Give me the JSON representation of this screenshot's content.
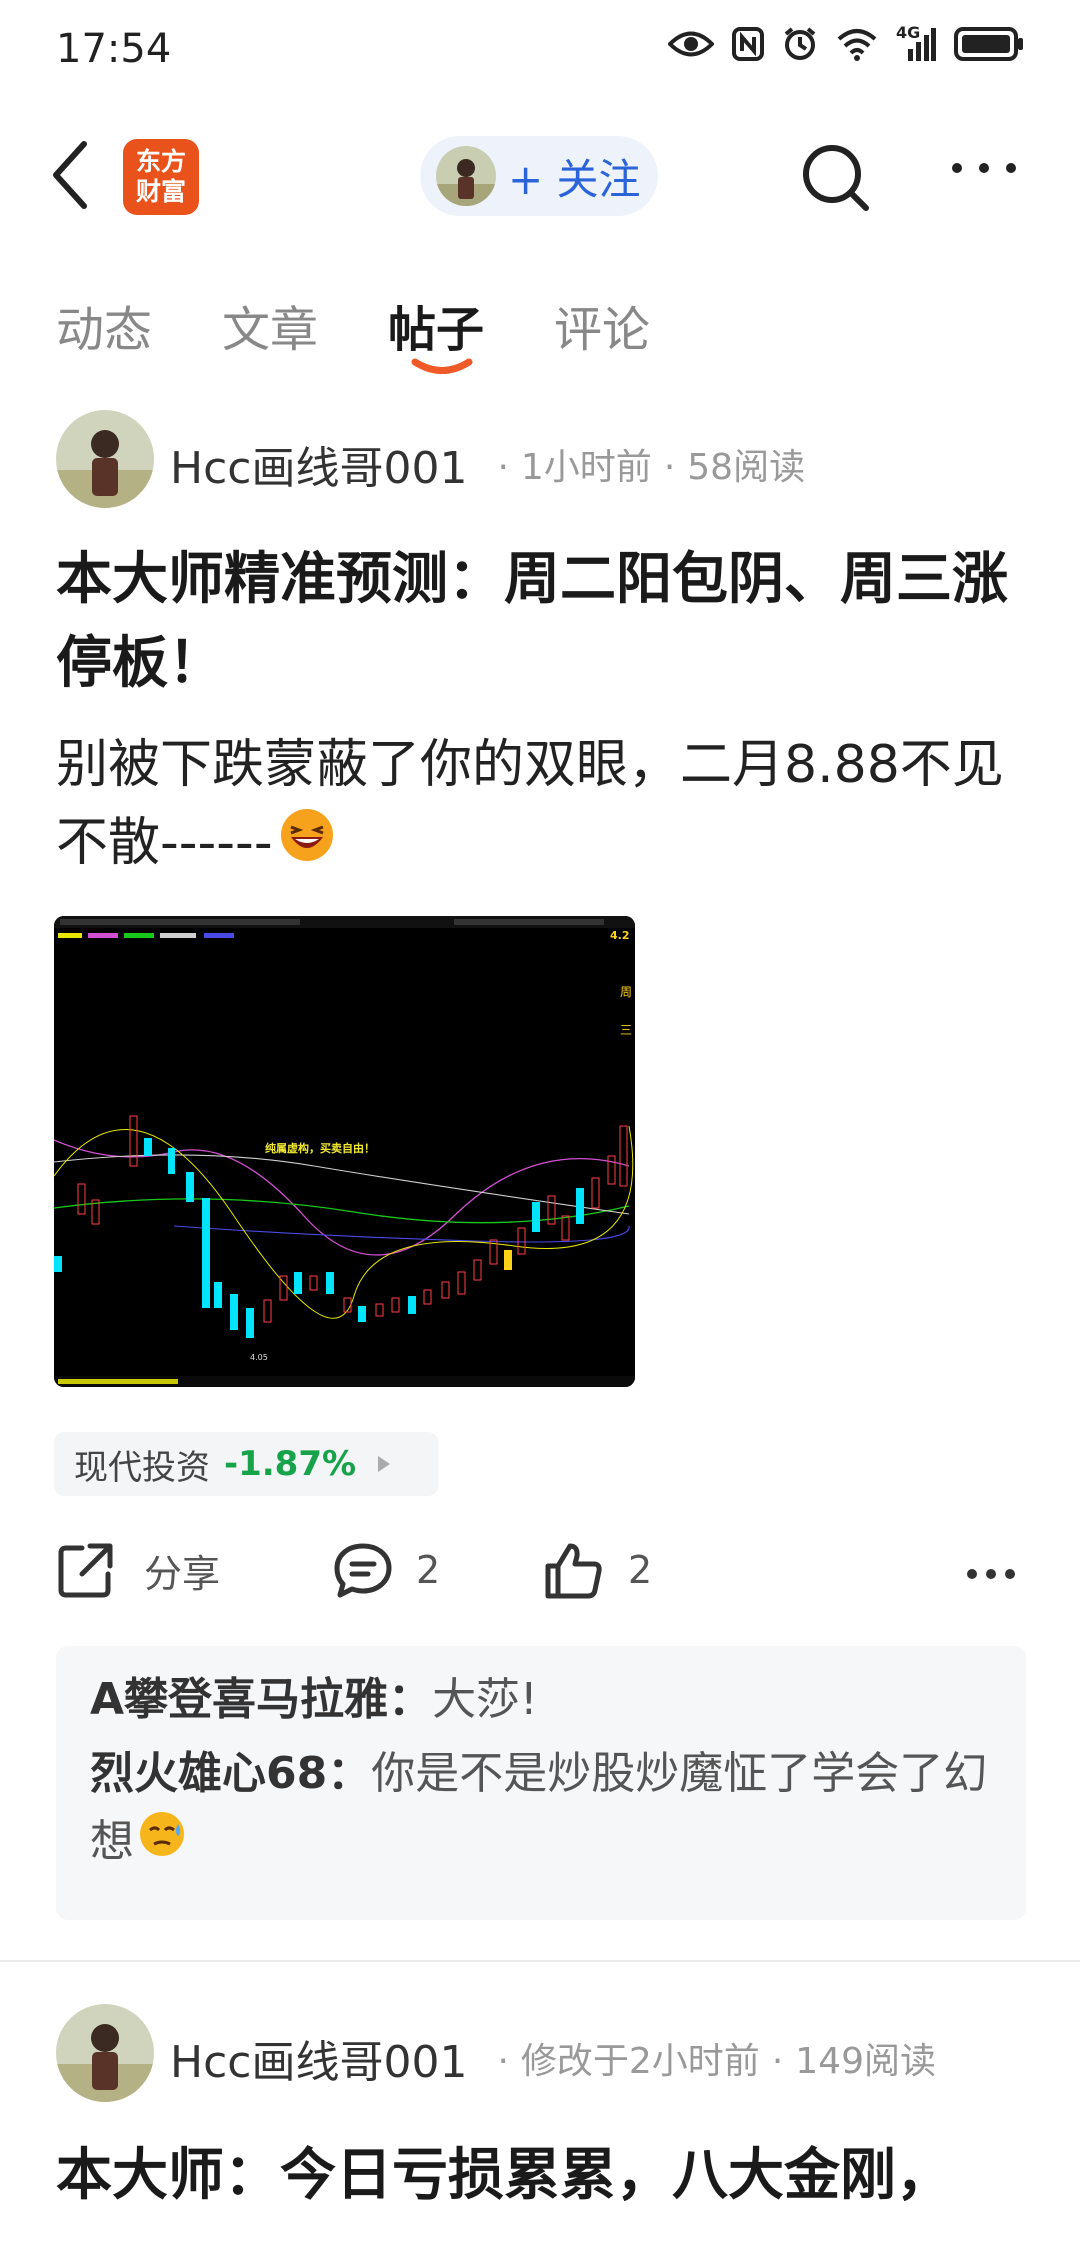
{
  "status_bar": {
    "time": "17:54",
    "network": "4G"
  },
  "header": {
    "logo_line1": "东方",
    "logo_line2": "财富",
    "follow_label": "+ 关注"
  },
  "tabs": [
    {
      "label": "动态",
      "active": false
    },
    {
      "label": "文章",
      "active": false
    },
    {
      "label": "帖子",
      "active": true
    },
    {
      "label": "评论",
      "active": false
    }
  ],
  "posts": [
    {
      "author": "Hcc画线哥001",
      "time": "1小时前",
      "reads": "58阅读",
      "title": "本大师精准预测：周二阳包阴、周三涨停板！",
      "body": "别被下跌蒙蔽了你的双眼，二月8.88不见不散------",
      "chart_caption": "纯属虚构，买卖自由！",
      "chart_low_label": "4.05",
      "chart_last_price": "4.2",
      "chart_side_text": [
        "周",
        "三"
      ],
      "stock_tag": {
        "name": "现代投资",
        "change": "-1.87%"
      },
      "actions": {
        "share_label": "分享",
        "comment_count": "2",
        "like_count": "2"
      },
      "comments": [
        {
          "user": "A攀登喜马拉雅",
          "text": "大莎!"
        },
        {
          "user": "烈火雄心68",
          "text": "你是不是炒股炒魔怔了学会了幻想"
        }
      ]
    },
    {
      "author": "Hcc画线哥001",
      "time": "修改于2小时前",
      "reads": "149阅读",
      "title": "本大师：今日亏损累累，八大金刚，"
    }
  ],
  "colors": {
    "accent_blue": "#2b63d8",
    "brand_orange": "#e9531b",
    "down_green": "#17a34a",
    "tab_underline": "#f05a28"
  }
}
